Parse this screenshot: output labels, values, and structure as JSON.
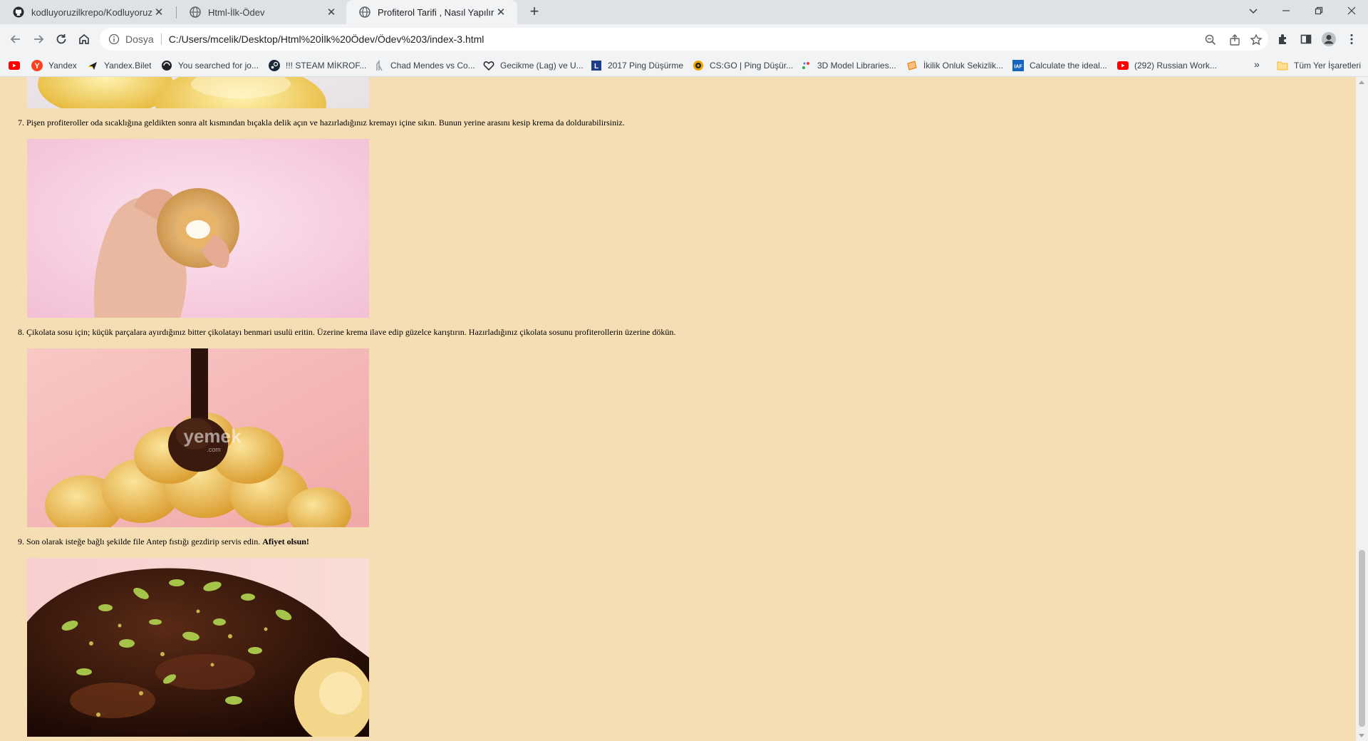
{
  "tabs": [
    {
      "title": "kodluyoruzilkrepo/Kodluyoruz ·",
      "icon": "github-icon"
    },
    {
      "title": "Html-İlk-Ödev",
      "icon": "globe-icon"
    },
    {
      "title": "Profiterol Tarifi , Nasıl Yapılır?",
      "icon": "globe-icon"
    }
  ],
  "address": {
    "scheme": "Dosya",
    "url": "C:/Users/mcelik/Desktop/Html%20İlk%20Ödev/Ödev%203/index-3.html"
  },
  "bookmarks": [
    {
      "label": "",
      "icon": "youtube-icon"
    },
    {
      "label": "Yandex",
      "icon": "yandex-icon"
    },
    {
      "label": "Yandex.Bilet",
      "icon": "plane-icon"
    },
    {
      "label": "You searched for jo...",
      "icon": "circle-icon"
    },
    {
      "label": "!!! STEAM MİKROF...",
      "icon": "steam-icon"
    },
    {
      "label": "Chad Mendes vs Co...",
      "icon": "mma-icon"
    },
    {
      "label": "Gecikme (Lag) ve U...",
      "icon": "heart-outline-icon"
    },
    {
      "label": "2017 Ping Düşürme",
      "icon": "book-icon"
    },
    {
      "label": "CS:GO | Ping Düşür...",
      "icon": "csgo-icon"
    },
    {
      "label": "3D Model Libraries...",
      "icon": "model-icon"
    },
    {
      "label": "İkilik Onluk Sekizlik...",
      "icon": "note-icon"
    },
    {
      "label": "Calculate the ideal...",
      "icon": "iaf-icon"
    },
    {
      "label": "(292) Russian Work...",
      "icon": "youtube-icon"
    }
  ],
  "bookmarks_other": "Tüm Yer İşaretleri",
  "steps": [
    {
      "number": "7.",
      "text": "Pişen profiteroller oda sıcaklığına geldikten sonra alt kısmından bıçakla delik açın ve hazırladığınız kremayı içine sıkın. Bunun yerine arasını kesip krema da doldurabilirsiniz.",
      "bold": ""
    },
    {
      "number": "8.",
      "text": "Çikolata sosu için; küçük parçalara ayırdığınız bitter çikolatayı benmari usulü eritin. Üzerine krema ilave edip güzelce karıştırın. Hazırladığınız çikolata sosunu profiterollerin üzerine dökün.",
      "bold": ""
    },
    {
      "number": "9.",
      "text": "Son olarak isteğe bağlı şekilde file Antep fıstığı gezdirip servis edin.",
      "bold": "Afiyet olsun!"
    }
  ],
  "photo_watermark": "yemek",
  "photo_watermark_sub": ".com",
  "colors": {
    "page_background": "#f5deb3",
    "chrome": "#dee1e6",
    "toolbar": "#f1f3f4"
  }
}
